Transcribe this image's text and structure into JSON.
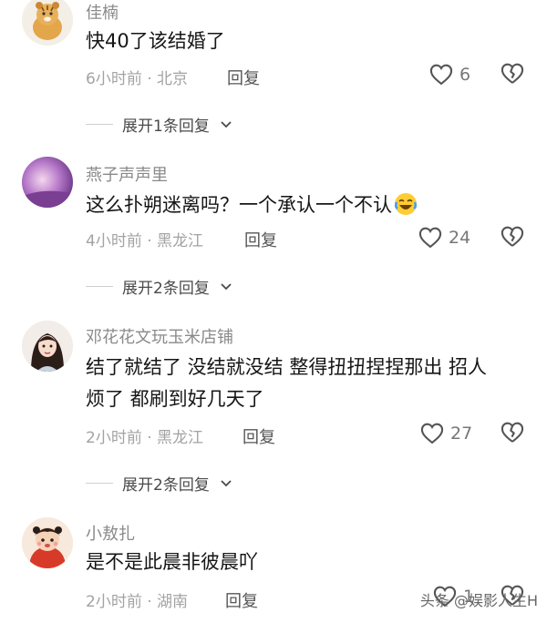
{
  "comments": [
    {
      "username": "佳楠",
      "text": "快40了该结婚了",
      "time": "6小时前",
      "location": "北京",
      "reply_label": "回复",
      "likes": "6",
      "expand_label": "展开1条回复"
    },
    {
      "username": "燕子声声里",
      "text": "这么扑朔迷离吗？一个承认一个不认",
      "time": "4小时前",
      "location": "黑龙江",
      "reply_label": "回复",
      "likes": "24",
      "expand_label": "展开2条回复"
    },
    {
      "username": "邓花花文玩玉米店铺",
      "text_line1": "结了就结了 没结就没结 整得扭扭捏捏那出 招人",
      "text_line2": "烦了 都刷到好几天了",
      "time": "2小时前",
      "location": "黑龙江",
      "reply_label": "回复",
      "likes": "27",
      "expand_label": "展开2条回复"
    },
    {
      "username": "小敖扎",
      "text": "是不是此晨非彼晨吖",
      "time": "2小时前",
      "location": "湖南",
      "reply_label": "回复",
      "likes": "1"
    }
  ],
  "separator": "·",
  "watermark": "头条 @娱影人生H",
  "icons": {
    "like": "heart-outline-icon",
    "dislike": "broken-heart-icon",
    "expand": "chevron-down-icon",
    "emoji": "laughing-crying-emoji"
  },
  "colors": {
    "username": "#8a8a8a",
    "text": "#161616",
    "meta": "#a3a3a3"
  }
}
